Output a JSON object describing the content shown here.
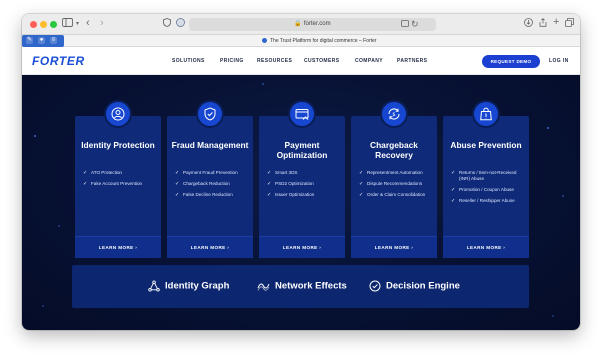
{
  "browser": {
    "url": "forter.com",
    "tab_title": "The Trust Platform for digital commerce – Forter",
    "icons": [
      "sidebar-icon",
      "back-icon",
      "forward-icon",
      "shield-icon",
      "translate-icon",
      "reader-icon",
      "reload-icon",
      "download-icon",
      "share-icon",
      "new-tab-icon",
      "tabs-overview-icon"
    ]
  },
  "nav": {
    "logo": "FORTER",
    "links": [
      "SOLUTIONS",
      "PRICING",
      "RESOURCES",
      "CUSTOMERS",
      "COMPANY",
      "PARTNERS"
    ],
    "cta": "REQUEST DEMO",
    "login": "LOG IN"
  },
  "cards": [
    {
      "title": "Identity Protection",
      "icon": "user-icon",
      "items": [
        "ATO Protection",
        "Fake Account Prevention"
      ],
      "cta": "LEARN MORE ›"
    },
    {
      "title": "Fraud Management",
      "icon": "shield-icon",
      "items": [
        "Payment Fraud Prevention",
        "Chargeback Reduction",
        "False Decline Reduction"
      ],
      "cta": "LEARN MORE ›"
    },
    {
      "title": "Payment Optimization",
      "icon": "card-icon",
      "items": [
        "Smart 3DS",
        "PSD2 Optimization",
        "Issuer Optimization"
      ],
      "cta": "LEARN MORE ›"
    },
    {
      "title": "Chargeback Recovery",
      "icon": "refresh-dollar-icon",
      "items": [
        "Representment Automation",
        "Dispute Recommendations",
        "Order & Claim Consolidation"
      ],
      "cta": "LEARN MORE ›"
    },
    {
      "title": "Abuse Prevention",
      "icon": "bag-icon",
      "items": [
        "Returns / Item-not-Received (INR) Abuse",
        "Promotion / Coupon Abuse",
        "Reseller / Reshipper Abuse"
      ],
      "cta": "LEARN MORE ›"
    }
  ],
  "features": [
    {
      "label": "Identity Graph",
      "icon": "graph-icon"
    },
    {
      "label": "Network Effects",
      "icon": "wave-icon"
    },
    {
      "label": "Decision Engine",
      "icon": "check-circle-icon"
    }
  ],
  "colors": {
    "brand": "#1a3fd1",
    "hero_bg": "#071133",
    "card_bg": "#0e2a78",
    "icon_bg": "#1747d1"
  }
}
